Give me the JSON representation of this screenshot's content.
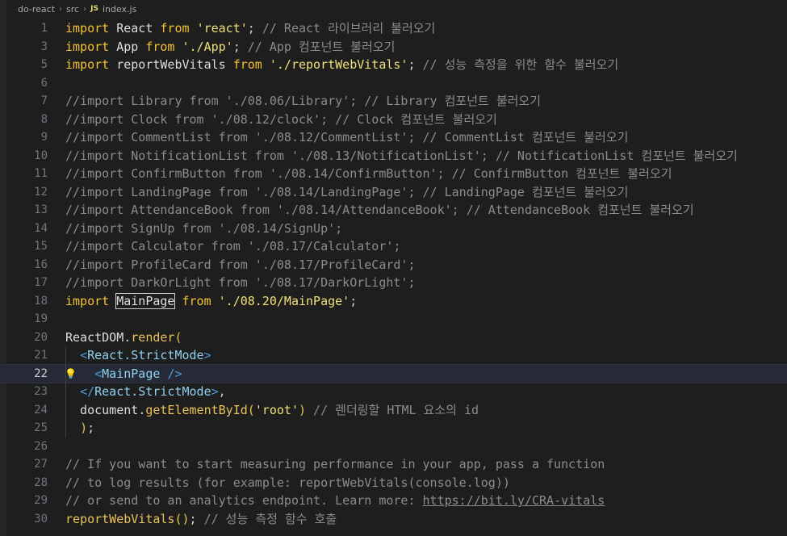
{
  "breadcrumb": {
    "project": "do-react",
    "folder": "src",
    "file_icon": "JS",
    "file": "index.js"
  },
  "lines": [
    {
      "n": "1",
      "tokens": [
        [
          "kw",
          "import"
        ],
        [
          "id",
          " React "
        ],
        [
          "kw",
          "from"
        ],
        [
          "id",
          " "
        ],
        [
          "str",
          "'react'"
        ],
        [
          "punc",
          ";"
        ],
        [
          "cm",
          " // React 라이브러리 불러오기"
        ]
      ]
    },
    {
      "n": "3",
      "tokens": [
        [
          "kw",
          "import"
        ],
        [
          "id",
          " App "
        ],
        [
          "kw",
          "from"
        ],
        [
          "id",
          " "
        ],
        [
          "str",
          "'./App'"
        ],
        [
          "punc",
          ";"
        ],
        [
          "cm",
          " // App 컴포넌트 불러오기"
        ]
      ]
    },
    {
      "n": "5",
      "tokens": [
        [
          "kw",
          "import"
        ],
        [
          "id",
          " reportWebVitals "
        ],
        [
          "kw",
          "from"
        ],
        [
          "id",
          " "
        ],
        [
          "str",
          "'./reportWebVitals'"
        ],
        [
          "punc",
          ";"
        ],
        [
          "cm",
          " // 성능 측정을 위한 함수 불러오기"
        ]
      ]
    },
    {
      "n": "6",
      "tokens": []
    },
    {
      "n": "7",
      "tokens": [
        [
          "cm",
          "//import Library from './08.06/Library'; // Library 컴포넌트 불러오기"
        ]
      ]
    },
    {
      "n": "8",
      "tokens": [
        [
          "cm",
          "//import Clock from './08.12/clock'; // Clock 컴포넌트 불러오기"
        ]
      ]
    },
    {
      "n": "9",
      "tokens": [
        [
          "cm",
          "//import CommentList from './08.12/CommentList'; // CommentList 컴포넌트 불러오기"
        ]
      ]
    },
    {
      "n": "10",
      "tokens": [
        [
          "cm",
          "//import NotificationList from './08.13/NotificationList'; // NotificationList 컴포넌트 불러오기"
        ]
      ]
    },
    {
      "n": "11",
      "tokens": [
        [
          "cm",
          "//import ConfirmButton from './08.14/ConfirmButton'; // ConfirmButton 컴포넌트 불러오기"
        ]
      ]
    },
    {
      "n": "12",
      "tokens": [
        [
          "cm",
          "//import LandingPage from './08.14/LandingPage'; // LandingPage 컴포넌트 불러오기"
        ]
      ]
    },
    {
      "n": "13",
      "tokens": [
        [
          "cm",
          "//import AttendanceBook from './08.14/AttendanceBook'; // AttendanceBook 컴포넌트 불러오기"
        ]
      ]
    },
    {
      "n": "14",
      "tokens": [
        [
          "cm",
          "//import SignUp from './08.14/SignUp';"
        ]
      ]
    },
    {
      "n": "15",
      "tokens": [
        [
          "cm",
          "//import Calculator from './08.17/Calculator';"
        ]
      ]
    },
    {
      "n": "16",
      "tokens": [
        [
          "cm",
          "//import ProfileCard from './08.17/ProfileCard';"
        ]
      ]
    },
    {
      "n": "17",
      "tokens": [
        [
          "cm",
          "//import DarkOrLight from './08.17/DarkOrLight';"
        ]
      ]
    },
    {
      "n": "18",
      "tokens": [
        [
          "kw",
          "import"
        ],
        [
          "id",
          " "
        ],
        [
          "sel",
          "MainPage"
        ],
        [
          "id",
          " "
        ],
        [
          "kw",
          "from"
        ],
        [
          "id",
          " "
        ],
        [
          "str",
          "'./08.20/MainPage'"
        ],
        [
          "punc",
          ";"
        ]
      ]
    },
    {
      "n": "19",
      "tokens": []
    },
    {
      "n": "20",
      "tokens": [
        [
          "id",
          "ReactDOM"
        ],
        [
          "punc",
          "."
        ],
        [
          "fn",
          "render"
        ],
        [
          "paren",
          "("
        ]
      ]
    },
    {
      "n": "21",
      "tokens": [
        [
          "id",
          "  "
        ],
        [
          "tag",
          "<"
        ],
        [
          "tagn",
          "React.StrictMode"
        ],
        [
          "tag",
          ">"
        ]
      ]
    },
    {
      "n": "22",
      "current": true,
      "tokens": [
        [
          "id",
          "    "
        ],
        [
          "tag",
          "<"
        ],
        [
          "tagn",
          "MainPage"
        ],
        [
          "id",
          " "
        ],
        [
          "tag",
          "/>"
        ]
      ]
    },
    {
      "n": "23",
      "tokens": [
        [
          "id",
          "  "
        ],
        [
          "tag",
          "</"
        ],
        [
          "tagn",
          "React.StrictMode"
        ],
        [
          "tag",
          ">"
        ],
        [
          "punc",
          ","
        ]
      ]
    },
    {
      "n": "24",
      "tokens": [
        [
          "id",
          "  document"
        ],
        [
          "punc",
          "."
        ],
        [
          "fn",
          "getElementById"
        ],
        [
          "paren",
          "("
        ],
        [
          "str",
          "'root'"
        ],
        [
          "paren",
          ")"
        ],
        [
          "cm",
          " // 렌더링할 HTML 요소의 id"
        ]
      ]
    },
    {
      "n": "25",
      "tokens": [
        [
          "id",
          "  "
        ],
        [
          "paren",
          ")"
        ],
        [
          "punc",
          ";"
        ]
      ]
    },
    {
      "n": "26",
      "tokens": []
    },
    {
      "n": "27",
      "tokens": [
        [
          "cm",
          "// If you want to start measuring performance in your app, pass a function"
        ]
      ]
    },
    {
      "n": "28",
      "tokens": [
        [
          "cm",
          "// to log results (for example: reportWebVitals(console.log))"
        ]
      ]
    },
    {
      "n": "29",
      "tokens": [
        [
          "cm",
          "// or send to an analytics endpoint. Learn more: "
        ],
        [
          "cmlink",
          "https://bit.ly/CRA-vitals"
        ]
      ]
    },
    {
      "n": "30",
      "tokens": [
        [
          "fn",
          "reportWebVitals"
        ],
        [
          "paren",
          "()"
        ],
        [
          "punc",
          ";"
        ],
        [
          "cm",
          " // 성능 측정 함수 호출"
        ]
      ]
    }
  ],
  "colors": {
    "background": "#1e1e1e",
    "keyword": "#f3c334",
    "string": "#f0e07a",
    "comment": "#8c8c8c",
    "tag": "#4f97d7"
  }
}
